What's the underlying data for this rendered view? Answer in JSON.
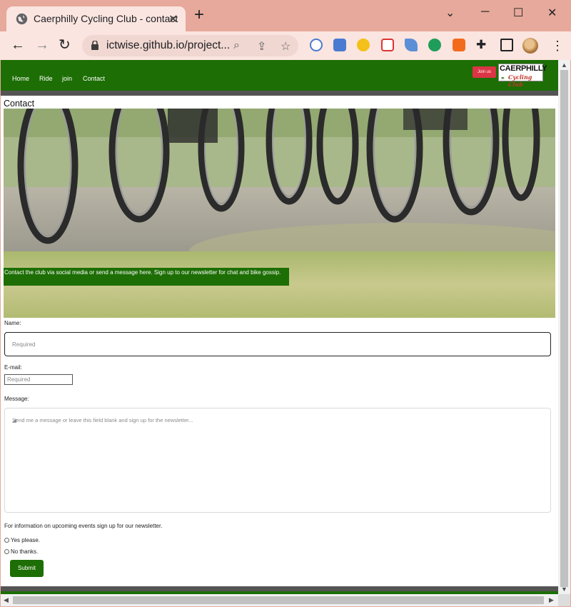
{
  "browser": {
    "tab_title": "Caerphilly Cycling Club - contact",
    "tab_close": "✕",
    "new_tab": "+",
    "url": "ictwise.github.io/project...",
    "window_controls": {
      "minimize": "─",
      "maximize": "☐",
      "close": "✕"
    },
    "back": "←",
    "forward": "→",
    "reload": "↻",
    "extensions": [
      "translate-icon",
      "google-translate-icon",
      "media-icon",
      "pocket-icon",
      "feather-icon",
      "sheets-icon",
      "security-icon",
      "puzzle-icon",
      "sidepanel-icon"
    ]
  },
  "site": {
    "nav": {
      "home": "Home",
      "ride": "Ride",
      "join": "join",
      "contact": "Contact"
    },
    "join_button": "Join us",
    "logo": {
      "top": "CAERPHILLY",
      "bottom": "Cycling Club"
    },
    "page_title": "Contact",
    "hero_caption": "Contact the club via social media or send a message here. Sign up to our newsletter for chat and bike gossip.",
    "form": {
      "name_label": "Name:",
      "name_placeholder": "Required",
      "email_label": "E-mail:",
      "email_placeholder": "Required",
      "message_label": "Message:",
      "message_placeholder": "Send me a message or leave this field blank and sign up for the newsletter...",
      "newsletter_prompt": "For information on upcoming events sign up for our newsletter.",
      "option_yes": "Yes please.",
      "option_no": "No thanks.",
      "submit": "Submit"
    }
  },
  "colors": {
    "brand_green": "#1d6e05",
    "join_red": "#dc3545",
    "chrome_frame": "#e6a99b"
  }
}
